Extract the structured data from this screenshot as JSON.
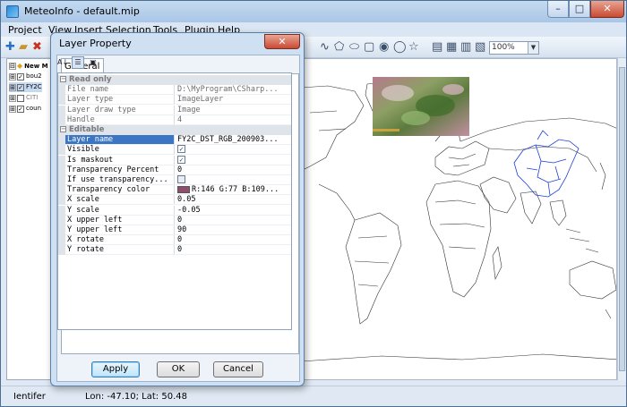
{
  "window": {
    "title": "MeteoInfo - default.mip",
    "min": "–",
    "max": "□",
    "close": "✕"
  },
  "menu": [
    "Project",
    "View",
    "Insert",
    "Selection",
    "Tools",
    "Plugin",
    "Help"
  ],
  "toolbar": {
    "zoom": "100%"
  },
  "legend": {
    "items": [
      {
        "label": "New M",
        "expand": "⊟",
        "checked": null
      },
      {
        "label": "bou2",
        "expand": "⊞",
        "checked": true
      },
      {
        "label": "FY2C",
        "expand": "⊞",
        "checked": true
      },
      {
        "label": "CITI",
        "expand": "⊞",
        "checked": false
      },
      {
        "label": "coun",
        "expand": "⊞",
        "checked": true
      }
    ]
  },
  "status": {
    "tool": "Ientifer",
    "coord": "Lon: -47.10; Lat: 50.48"
  },
  "dialog": {
    "title": "Layer Property",
    "close": "✕",
    "tab": "General",
    "toolbar_icons": [
      "sort-az-icon",
      "categorized-icon",
      "property-pages-icon"
    ],
    "categories": {
      "readonly": "Read only",
      "editable": "Editable"
    },
    "readonly_props": [
      {
        "name": "File name",
        "value": "D:\\MyProgram\\CSharp..."
      },
      {
        "name": "Layer type",
        "value": "ImageLayer"
      },
      {
        "name": "Layer draw type",
        "value": "Image"
      },
      {
        "name": "Handle",
        "value": "4"
      }
    ],
    "editable_props": [
      {
        "name": "Layer name",
        "value": "FY2C_DST_RGB_200903..."
      },
      {
        "name": "Visible",
        "value": ""
      },
      {
        "name": "Is maskout",
        "value": ""
      },
      {
        "name": "Transparency Percent",
        "value": "0"
      },
      {
        "name": "If use transparency...",
        "value": ""
      },
      {
        "name": "Transparency color",
        "value": "R:146 G:77 B:109..."
      },
      {
        "name": "X scale",
        "value": "0.05"
      },
      {
        "name": "Y scale",
        "value": "-0.05"
      },
      {
        "name": "X upper left",
        "value": "0"
      },
      {
        "name": "Y upper left",
        "value": "90"
      },
      {
        "name": "X rotate",
        "value": "0"
      },
      {
        "name": "Y rotate",
        "value": "0"
      }
    ],
    "checks": {
      "visible": true,
      "maskout": true,
      "use_transparency": false
    },
    "transparency_color": "#924d6d",
    "buttons": {
      "apply": "Apply",
      "ok": "OK",
      "cancel": "Cancel"
    }
  }
}
